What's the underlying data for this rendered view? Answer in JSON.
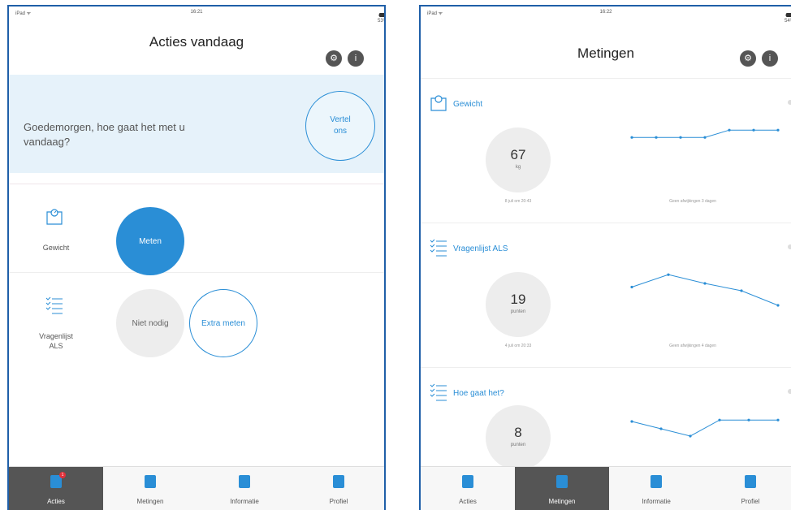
{
  "colors": {
    "accent": "#2a8ed6",
    "greeting_bg": "#e6f2fa",
    "tab_active": "#555555",
    "badge": "#e0303a",
    "frame": "#1f5fa8"
  },
  "left": {
    "status": {
      "left": "iPad ᯤ",
      "time": "16:21",
      "battery": "⁕ ⟲ 53%"
    },
    "title": "Acties vandaag",
    "greeting": "Goedemorgen, hoe gaat het met u vandaag?",
    "vertel_button": "Vertel ons",
    "actions": [
      {
        "label": "Gewicht",
        "icon": "scale-icon",
        "primary_button": "Meten"
      },
      {
        "label": "Vragenlijst ALS",
        "icon": "checklist-icon",
        "secondary_button": "Niet nodig",
        "extra_button": "Extra meten"
      }
    ],
    "tabs": [
      {
        "label": "Acties",
        "icon": "check-icon",
        "badge": "1",
        "active": true
      },
      {
        "label": "Metingen",
        "icon": "chart-icon",
        "active": false
      },
      {
        "label": "Informatie",
        "icon": "document-icon",
        "active": false
      },
      {
        "label": "Profiel",
        "icon": "profile-icon",
        "active": false
      }
    ]
  },
  "right": {
    "status": {
      "left": "iPad ᯤ",
      "time": "16:22",
      "battery": "⁕ ⟲ 54%"
    },
    "title": "Metingen",
    "measurements": [
      {
        "title": "Gewicht",
        "icon": "scale-icon",
        "value": "67",
        "unit": "kg",
        "time": "8 juli om 20:43",
        "note": "Geen afwijkingen 3 dagen",
        "trend": [
          0.62,
          0.62,
          0.62,
          0.62,
          0.72,
          0.72,
          0.72
        ]
      },
      {
        "title": "Vragenlijst ALS",
        "icon": "checklist-icon",
        "value": "19",
        "unit": "punten",
        "time": "4 juli om 20:33",
        "note": "Geen afwijkingen 4 dagen",
        "trend": [
          0.55,
          0.72,
          0.6,
          0.5,
          0.3
        ]
      },
      {
        "title": "Hoe gaat het?",
        "icon": "checklist-icon",
        "value": "8",
        "unit": "punten",
        "time": "",
        "note": "",
        "trend": [
          0.6,
          0.5,
          0.4,
          0.62,
          0.62,
          0.62
        ]
      }
    ],
    "tabs": [
      {
        "label": "Acties",
        "icon": "check-icon",
        "active": false
      },
      {
        "label": "Metingen",
        "icon": "chart-icon",
        "active": true
      },
      {
        "label": "Informatie",
        "icon": "document-icon",
        "active": false
      },
      {
        "label": "Profiel",
        "icon": "profile-icon",
        "active": false
      }
    ]
  }
}
